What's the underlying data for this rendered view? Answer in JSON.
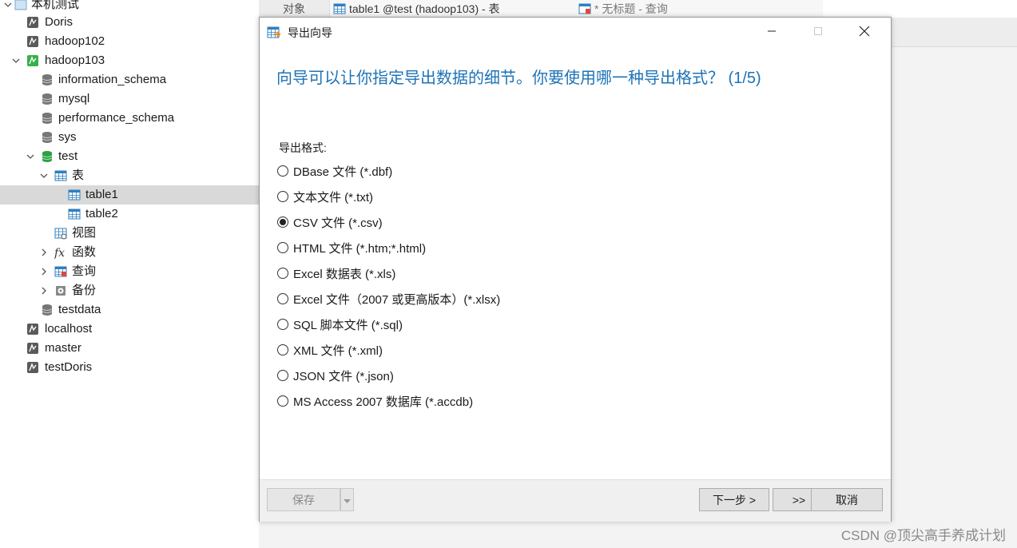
{
  "sidebar": {
    "items": [
      {
        "label": "本机测试",
        "icon": "folder-icon",
        "level": 0,
        "expanded": true
      },
      {
        "label": "Doris",
        "icon": "mysql-connection-icon",
        "level": 1
      },
      {
        "label": "hadoop102",
        "icon": "mysql-connection-icon",
        "level": 1
      },
      {
        "label": "hadoop103",
        "icon": "mysql-connection-active-icon",
        "level": 1,
        "expanded": true
      },
      {
        "label": "information_schema",
        "icon": "database-icon",
        "level": 2
      },
      {
        "label": "mysql",
        "icon": "database-icon",
        "level": 2
      },
      {
        "label": "performance_schema",
        "icon": "database-icon",
        "level": 2
      },
      {
        "label": "sys",
        "icon": "database-icon",
        "level": 2
      },
      {
        "label": "test",
        "icon": "database-active-icon",
        "level": 2,
        "expanded": true
      },
      {
        "label": "表",
        "icon": "table-group-icon",
        "level": 3,
        "expanded": true
      },
      {
        "label": "table1",
        "icon": "table-icon",
        "level": 4,
        "selected": true
      },
      {
        "label": "table2",
        "icon": "table-icon",
        "level": 4
      },
      {
        "label": "视图",
        "icon": "view-icon",
        "level": 3
      },
      {
        "label": "函数",
        "icon": "function-icon",
        "level": 3
      },
      {
        "label": "查询",
        "icon": "query-icon",
        "level": 3
      },
      {
        "label": "备份",
        "icon": "backup-icon",
        "level": 3
      },
      {
        "label": "testdata",
        "icon": "database-icon",
        "level": 2
      },
      {
        "label": "localhost",
        "icon": "mysql-connection-icon",
        "level": 1
      },
      {
        "label": "master",
        "icon": "mysql-connection-icon",
        "level": 1
      },
      {
        "label": "testDoris",
        "icon": "mysql-connection-icon",
        "level": 1
      }
    ]
  },
  "tabs": [
    {
      "label": "对象"
    },
    {
      "label": "table1 @test (hadoop103) - 表"
    },
    {
      "label": "* 无标题 - 查询"
    }
  ],
  "dialog": {
    "title": "导出向导",
    "heading": "向导可以让你指定导出数据的细节。你要使用哪一种导出格式？ (1/5)",
    "format_label": "导出格式:",
    "options": [
      {
        "label": "DBase 文件 (*.dbf)",
        "checked": false
      },
      {
        "label": "文本文件 (*.txt)",
        "checked": false
      },
      {
        "label": "CSV 文件 (*.csv)",
        "checked": true
      },
      {
        "label": "HTML 文件 (*.htm;*.html)",
        "checked": false
      },
      {
        "label": "Excel 数据表 (*.xls)",
        "checked": false
      },
      {
        "label": "Excel 文件（2007 或更高版本）(*.xlsx)",
        "checked": false
      },
      {
        "label": "SQL 脚本文件 (*.sql)",
        "checked": false
      },
      {
        "label": "XML 文件 (*.xml)",
        "checked": false
      },
      {
        "label": "JSON 文件 (*.json)",
        "checked": false
      },
      {
        "label": "MS Access 2007 数据库 (*.accdb)",
        "checked": false
      }
    ],
    "buttons": {
      "save": "保存",
      "next": "下一步 >",
      "skip": ">>",
      "cancel": "取消"
    }
  },
  "watermark": "CSDN @顶尖高手养成计划",
  "colors": {
    "heading": "#1e73b6",
    "selected_row": "#d9d9d9",
    "footer": "#f0f0f0"
  }
}
